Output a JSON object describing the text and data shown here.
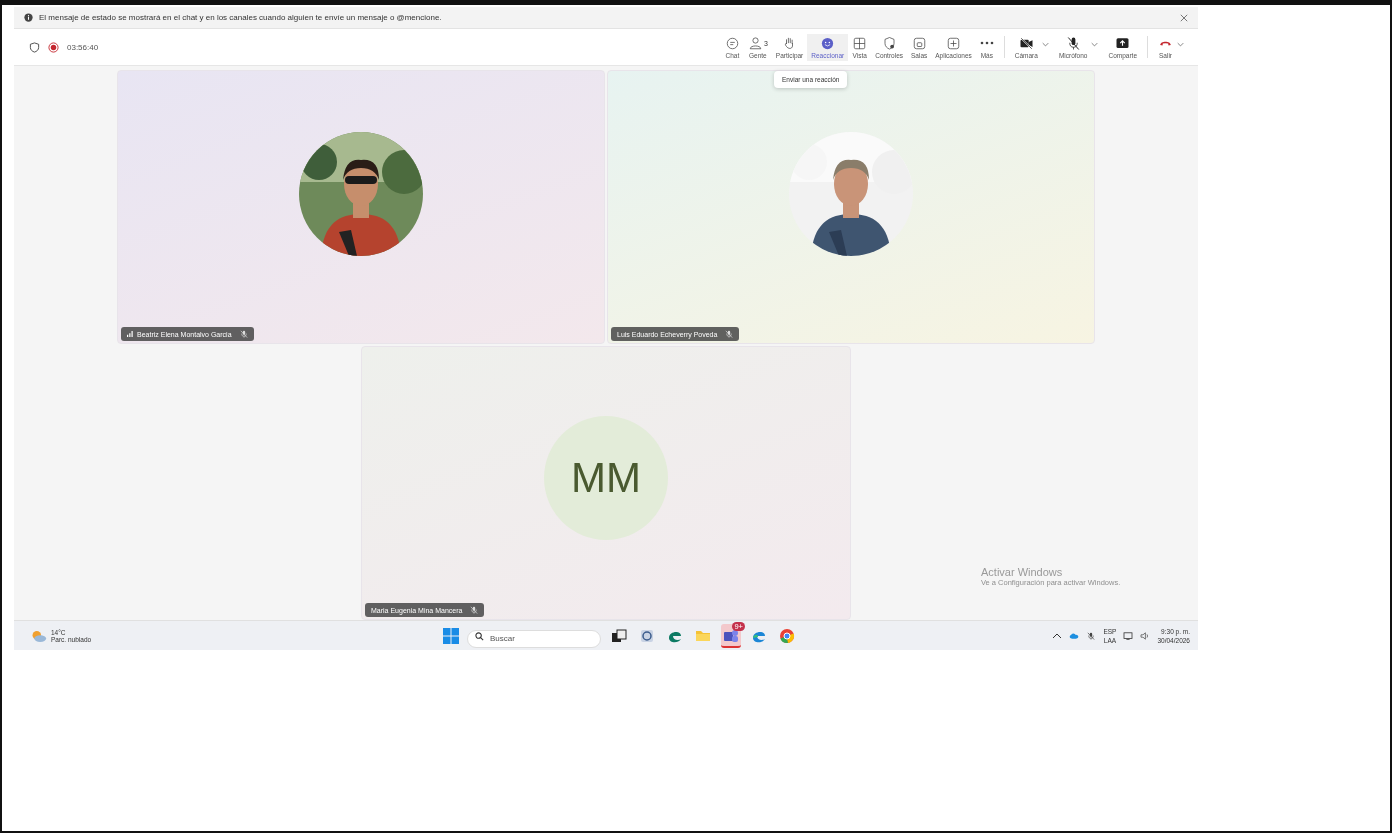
{
  "notice": {
    "text": "El mensaje de estado se mostrará en el chat y en los canales cuando alguien te envíe un mensaje o @mencione."
  },
  "meeting": {
    "recording": true,
    "timer": "03:56:40"
  },
  "toolbar": [
    {
      "kind": "chat",
      "label": "Chat",
      "selected": false
    },
    {
      "kind": "people",
      "label": "Gente",
      "count": "3",
      "selected": false
    },
    {
      "kind": "hand",
      "label": "Participar",
      "selected": false
    },
    {
      "kind": "react",
      "label": "Reaccionar",
      "selected": true
    },
    {
      "kind": "grid",
      "label": "Vista",
      "selected": false
    },
    {
      "kind": "shield",
      "label": "Controles",
      "selected": false
    },
    {
      "kind": "rooms",
      "label": "Salas",
      "selected": false
    },
    {
      "kind": "apps",
      "label": "Aplicaciones",
      "selected": false
    },
    {
      "kind": "more",
      "label": "Más",
      "selected": false
    },
    {
      "kind": "camera",
      "label": "Cámara",
      "selected": false,
      "dropdown": true,
      "divider_before": true
    },
    {
      "kind": "mic",
      "label": "Micrófono",
      "selected": false,
      "dropdown": true
    },
    {
      "kind": "share",
      "label": "Comparte",
      "selected": false
    },
    {
      "kind": "leave",
      "label": "Salir",
      "selected": false,
      "dropdown": true,
      "divider_before": true
    }
  ],
  "tooltip": {
    "text": "Enviar una reacción"
  },
  "participants": [
    {
      "name": "Beatriz Elena Montalvo Garcia",
      "muted": true,
      "signal": true
    },
    {
      "name": "Luis Eduardo Echeverry Poveda",
      "muted": true,
      "signal": false
    },
    {
      "name": "Maria Eugenia Mina Mancera",
      "muted": true,
      "signal": false,
      "avatar": {
        "kind": "initials",
        "text": "MM"
      }
    }
  ],
  "activation": {
    "title": "Activar Windows",
    "subtitle": "Ve a Configuración para activar Windows."
  },
  "taskbar": {
    "weather": {
      "temp": "14°C",
      "condition": "Parc. nublado"
    },
    "search": {
      "placeholder": "Buscar"
    },
    "apps": [
      {
        "kind": "taskview",
        "selected": false
      },
      {
        "kind": "tool",
        "selected": false
      },
      {
        "kind": "edge-dev",
        "selected": false
      },
      {
        "kind": "folder",
        "selected": false
      },
      {
        "kind": "teams",
        "selected": true,
        "badge": "9+"
      },
      {
        "kind": "edge",
        "selected": false
      },
      {
        "kind": "chrome",
        "selected": false
      }
    ],
    "tray": {
      "language": "ESP",
      "layout": "LAA",
      "time": "9:30 p. m.",
      "date": "30/04/2026"
    }
  }
}
